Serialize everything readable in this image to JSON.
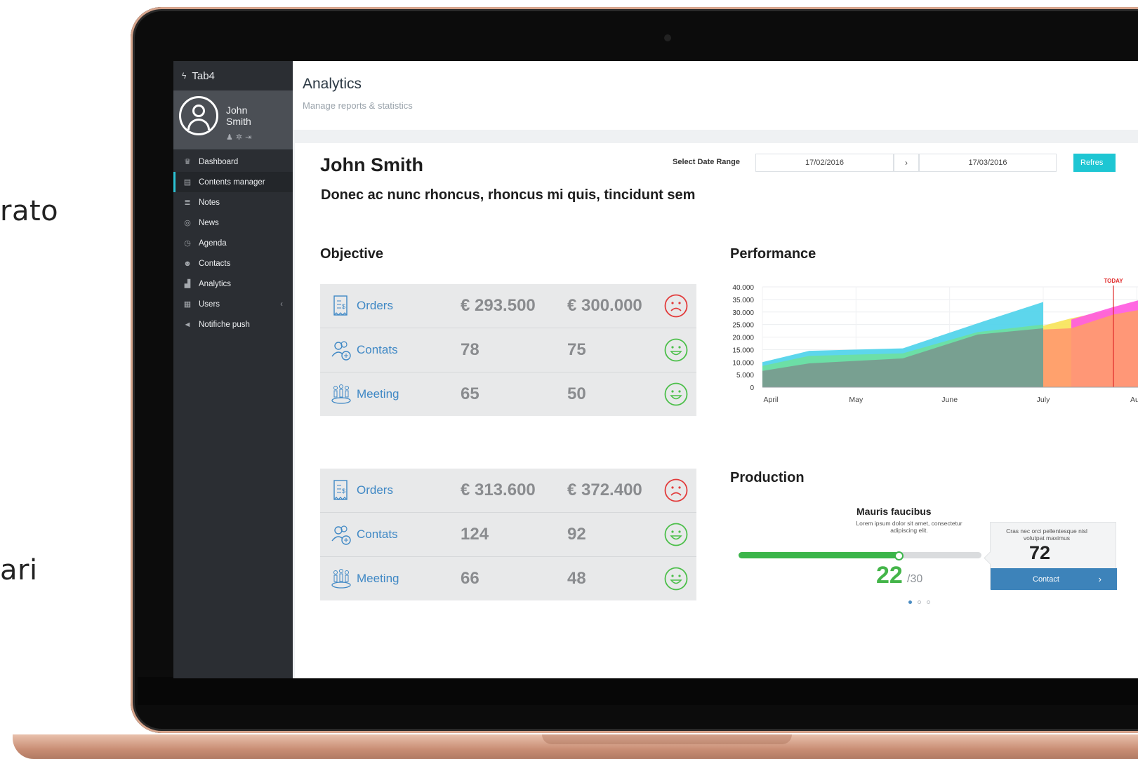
{
  "background": {
    "text_left_1": "rato",
    "text_left_2": "ari"
  },
  "app": {
    "brand": "Tab4",
    "user": {
      "first": "John",
      "last": "Smith"
    },
    "menu": [
      {
        "label": "Dashboard",
        "icon": "trophy-icon"
      },
      {
        "label": "Contents manager",
        "icon": "film-icon",
        "active": true
      },
      {
        "label": "Notes",
        "icon": "note-icon"
      },
      {
        "label": "News",
        "icon": "broadcast-icon"
      },
      {
        "label": "Agenda",
        "icon": "stopwatch-icon"
      },
      {
        "label": "Contacts",
        "icon": "people-icon"
      },
      {
        "label": "Analytics",
        "icon": "bar-chart-icon"
      },
      {
        "label": "Users",
        "icon": "table-icon"
      },
      {
        "label": "Notifiche push",
        "icon": "megaphone-icon"
      }
    ]
  },
  "header": {
    "title": "Analytics",
    "subtitle": "Manage reports & statistics"
  },
  "card": {
    "name": "John Smith",
    "subtitle": "Donec ac nunc rhoncus, rhoncus mi quis, tincidunt sem",
    "date_label": "Select Date Range",
    "date_from": "17/02/2016",
    "date_sep": "›",
    "date_to": "17/03/2016",
    "refresh": "Refres"
  },
  "objective": {
    "title": "Objective",
    "tables": [
      [
        {
          "label": "Orders",
          "v1": "€ 293.500",
          "v2": "€ 300.000",
          "mood": "sad"
        },
        {
          "label": "Contats",
          "v1": "78",
          "v2": "75",
          "mood": "happy"
        },
        {
          "label": "Meeting",
          "v1": "65",
          "v2": "50",
          "mood": "happy"
        }
      ],
      [
        {
          "label": "Orders",
          "v1": "€ 313.600",
          "v2": "€ 372.400",
          "mood": "sad"
        },
        {
          "label": "Contats",
          "v1": "124",
          "v2": "92",
          "mood": "happy"
        },
        {
          "label": "Meeting",
          "v1": "66",
          "v2": "48",
          "mood": "happy"
        }
      ]
    ]
  },
  "performance": {
    "title": "Performance"
  },
  "chart_data": {
    "type": "area",
    "title": "Performance",
    "x": [
      0,
      1,
      2,
      3,
      4,
      5,
      6,
      7
    ],
    "x_tick_labels": [
      "April",
      "May",
      "June",
      "July",
      "Aug"
    ],
    "x_tick_positions": [
      0,
      1,
      2,
      3,
      4
    ],
    "ylim": [
      0,
      40000
    ],
    "yticks": [
      0,
      5000,
      10000,
      15000,
      20000,
      25000,
      30000,
      35000,
      40000
    ],
    "ytick_labels": [
      "0",
      "5.000",
      "10.000",
      "15.000",
      "20.000",
      "25.000",
      "30.000",
      "35.000",
      "40.000"
    ],
    "xlim": [
      0,
      4.05
    ],
    "today_x": 3.75,
    "today_label": "TODAY",
    "series": [
      {
        "color": "#4fd3ea",
        "points": [
          [
            0,
            10000
          ],
          [
            0.5,
            14500
          ],
          [
            1.5,
            15500
          ],
          [
            2.3,
            25500
          ],
          [
            3,
            34000
          ]
        ]
      },
      {
        "color": "#6ee0a0",
        "points": [
          [
            0,
            8500
          ],
          [
            0.5,
            12500
          ],
          [
            1.5,
            13500
          ],
          [
            2.3,
            22000
          ],
          [
            3,
            25000
          ]
        ]
      },
      {
        "color": "#7a9a8f",
        "points": [
          [
            0,
            6500
          ],
          [
            0.5,
            9500
          ],
          [
            1.5,
            11500
          ],
          [
            2.3,
            21000
          ],
          [
            3,
            23500
          ]
        ]
      },
      {
        "color": "#f7e45a",
        "points": [
          [
            3,
            24500
          ],
          [
            3.3,
            27500
          ],
          [
            3.75,
            31000
          ]
        ]
      },
      {
        "color": "#ff5be0",
        "points": [
          [
            3.3,
            27000
          ],
          [
            3.75,
            32000
          ],
          [
            4.05,
            35000
          ]
        ]
      },
      {
        "color": "#ff9b6e",
        "points": [
          [
            3,
            23000
          ],
          [
            3.3,
            23500
          ],
          [
            3.75,
            29000
          ],
          [
            4.05,
            31000
          ]
        ]
      }
    ]
  },
  "production": {
    "title": "Production",
    "item_title": "Mauris faucibus",
    "item_desc": "Lorem ipsum dolor sit amet, consectetur adipiscing elit.",
    "score": "22",
    "total": "/30",
    "progress": 0.66,
    "tip_text": "Cras nec orci pellentesque nisl volutpat maximus",
    "tip_value": "72",
    "tip_button": "Contact",
    "tip_arrow": "›",
    "dots": 3
  }
}
